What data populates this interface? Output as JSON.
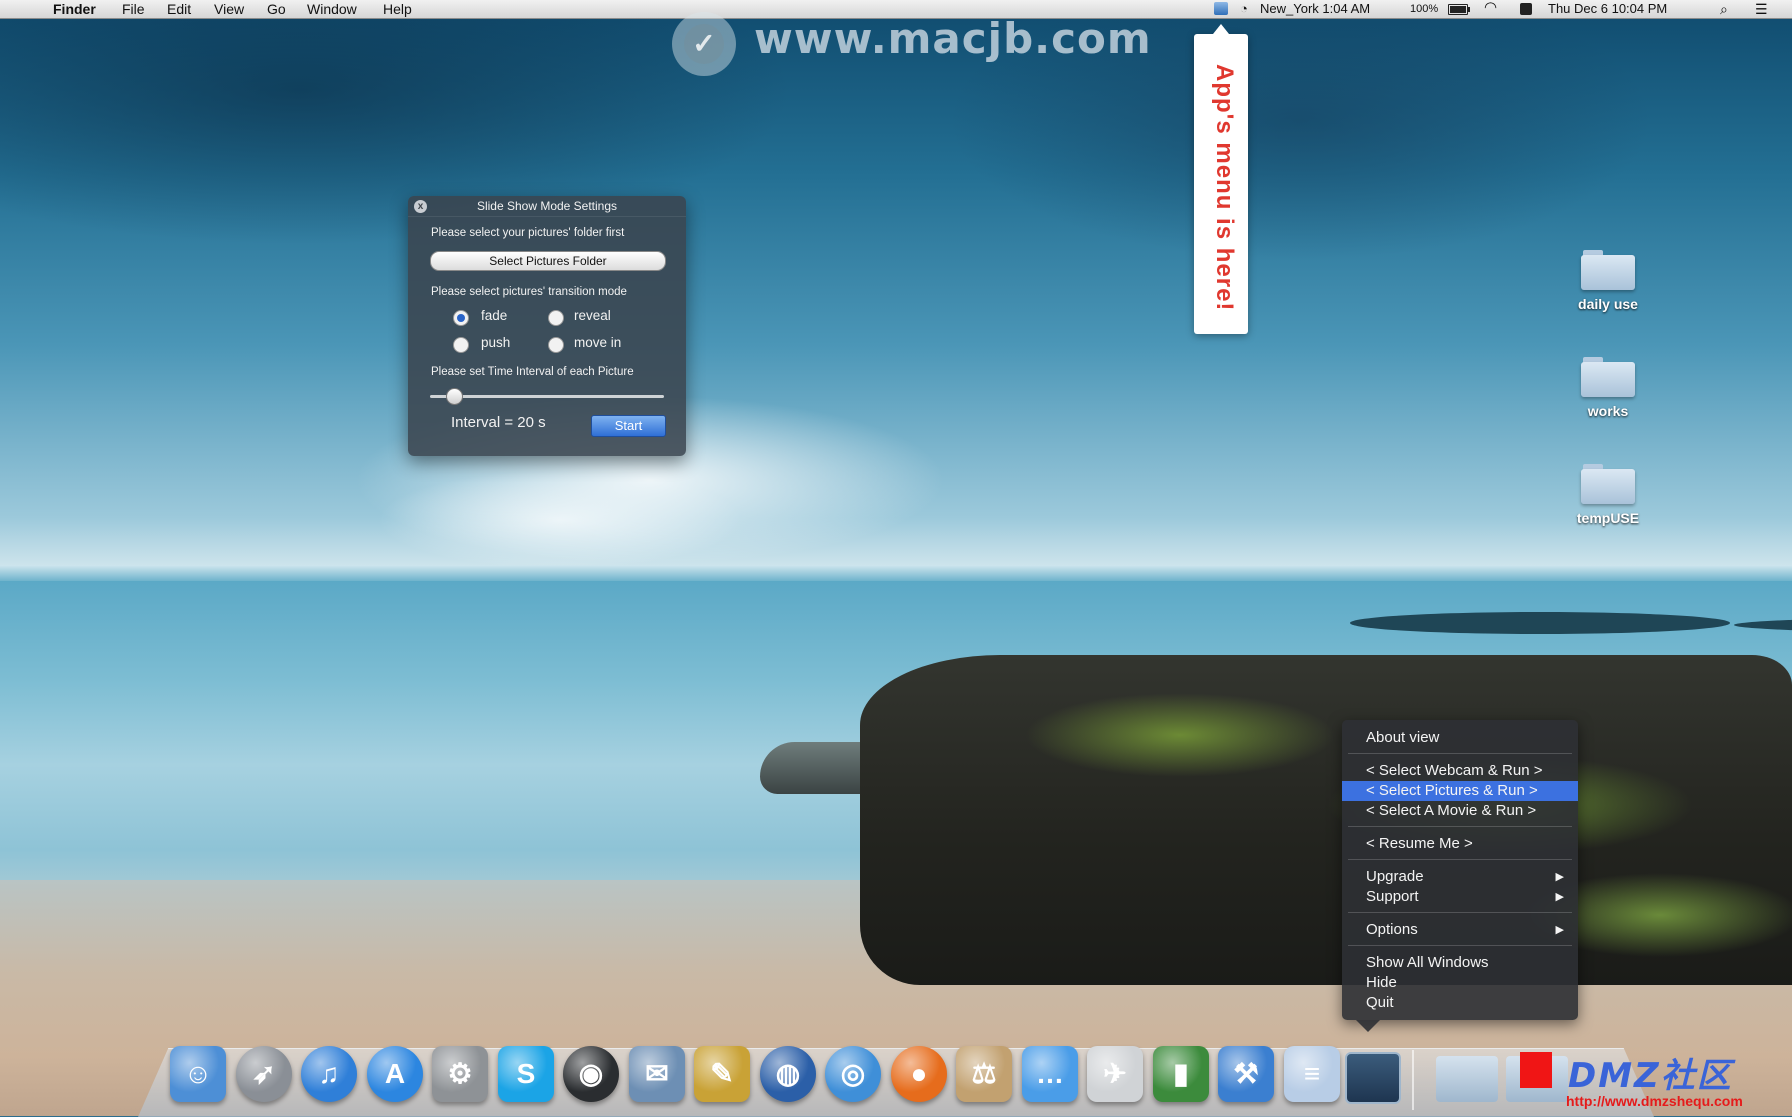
{
  "menubar": {
    "apple_glyph": "",
    "app_name": "Finder",
    "menus": [
      "File",
      "Edit",
      "View",
      "Go",
      "Window",
      "Help"
    ],
    "clock_city": "New_York 1:04 AM",
    "battery": "100%",
    "datetime": "Thu Dec 6  10:04 PM"
  },
  "watermark": {
    "logo_glyph": "✓",
    "site": "www.macjb.com"
  },
  "callout": {
    "text": "App's menu is here!"
  },
  "settings": {
    "title": "Slide Show Mode Settings",
    "close_glyph": "x",
    "folder_prompt": "Please select your pictures' folder first",
    "folder_button": "Select Pictures Folder",
    "transition_prompt": "Please select pictures' transition mode",
    "transitions": [
      {
        "label": "fade",
        "checked": true
      },
      {
        "label": "reveal",
        "checked": false
      },
      {
        "label": "push",
        "checked": false
      },
      {
        "label": "move in",
        "checked": false
      }
    ],
    "interval_prompt": "Please set Time Interval of each Picture",
    "interval_slider_fraction": 0.1,
    "interval_text": "Interval = 20 s",
    "start_button": "Start"
  },
  "desktop_folders": [
    {
      "label": "daily use"
    },
    {
      "label": "works"
    },
    {
      "label": "tempUSE"
    }
  ],
  "context_menu": {
    "items": [
      {
        "label": "About view"
      },
      {
        "label": "< Select Webcam & Run >"
      },
      {
        "label": "< Select Pictures & Run >",
        "highlighted": true
      },
      {
        "label": "< Select A Movie & Run >"
      },
      {
        "label": "< Resume Me >"
      },
      {
        "label": "Upgrade",
        "submenu": true
      },
      {
        "label": "Support",
        "submenu": true
      },
      {
        "label": "Options",
        "submenu": true
      },
      {
        "label": "Show All Windows"
      },
      {
        "label": "Hide"
      },
      {
        "label": "Quit"
      }
    ],
    "submenu_glyph": "▶"
  },
  "dock": {
    "apps": [
      {
        "name": "finder-icon",
        "glyph": "☺",
        "color": "#4d8fd6"
      },
      {
        "name": "launchpad-icon",
        "glyph": "➶",
        "color": "#8a8f96"
      },
      {
        "name": "itunes-icon",
        "glyph": "♫",
        "color": "#2f7fd8"
      },
      {
        "name": "app-store-icon",
        "glyph": "A",
        "color": "#2c86e0"
      },
      {
        "name": "system-preferences-icon",
        "glyph": "⚙",
        "color": "#8e9296"
      },
      {
        "name": "skype-icon",
        "glyph": "S",
        "color": "#1ba4e6"
      },
      {
        "name": "dashboard-icon",
        "glyph": "◉",
        "color": "#2a2d30"
      },
      {
        "name": "preview-icon",
        "glyph": "✉",
        "color": "#6d8fb4"
      },
      {
        "name": "paint-icon",
        "glyph": "✎",
        "color": "#c9a236"
      },
      {
        "name": "google-earth-icon",
        "glyph": "◍",
        "color": "#2b5fa8"
      },
      {
        "name": "safari-icon",
        "glyph": "◎",
        "color": "#3f8fd8"
      },
      {
        "name": "firefox-icon",
        "glyph": "●",
        "color": "#e66c1c"
      },
      {
        "name": "archive-utility-icon",
        "glyph": "⚖",
        "color": "#c2a170"
      },
      {
        "name": "messages-icon",
        "glyph": "…",
        "color": "#4a9de8"
      },
      {
        "name": "textedit-rocket-icon",
        "glyph": "✈",
        "color": "#d0d3d6"
      },
      {
        "name": "activity-monitor-icon",
        "glyph": "▮",
        "color": "#3c8b3c"
      },
      {
        "name": "xcode-icon",
        "glyph": "⚒",
        "color": "#3b7fd0"
      },
      {
        "name": "text-document-icon",
        "glyph": "≡",
        "color": "#b8cde6"
      }
    ]
  },
  "dmz_watermark": {
    "text": "DMZ社区",
    "url": "http://www.dmzshequ.com"
  },
  "colors": {
    "menu_highlight": "#3c71e0",
    "callout_text": "#e0382f",
    "start_button": "#2f6fd6"
  }
}
